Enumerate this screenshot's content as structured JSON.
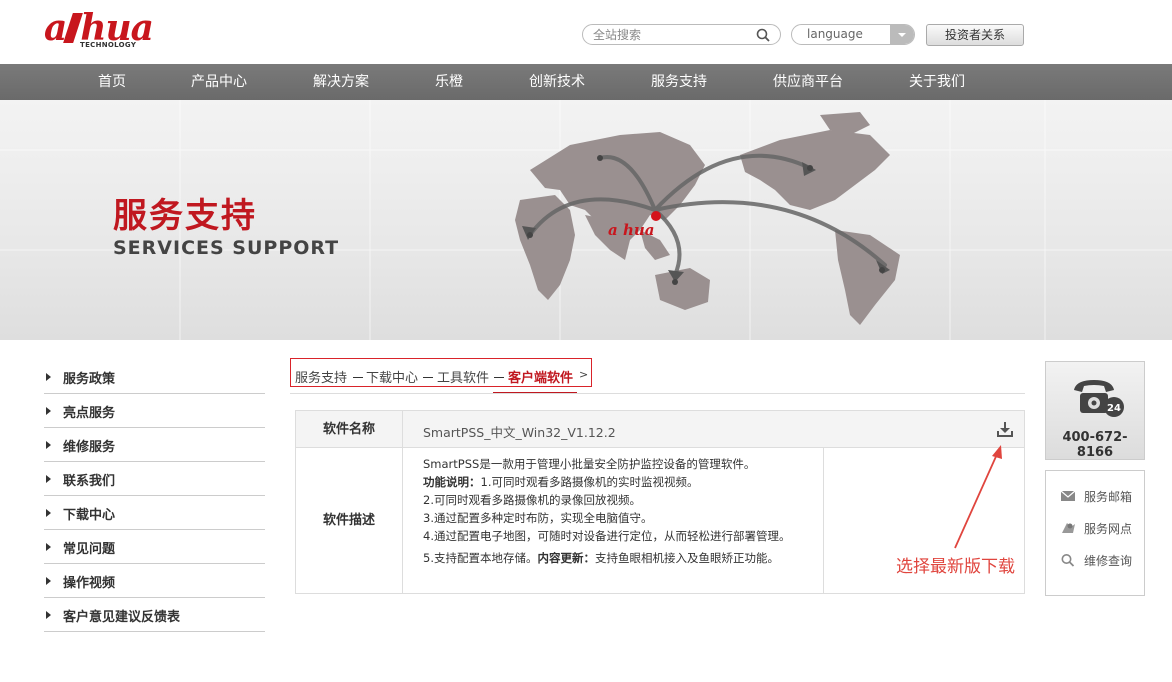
{
  "header": {
    "logo_text": "a",
    "logo_text_rest": "hua",
    "logo_sub": "TECHNOLOGY",
    "search_placeholder": "全站搜索",
    "language_label": "language",
    "investor_button": "投资者关系"
  },
  "nav": {
    "items": [
      {
        "label": "首页"
      },
      {
        "label": "产品中心"
      },
      {
        "label": "解决方案"
      },
      {
        "label": "乐橙"
      },
      {
        "label": "创新技术"
      },
      {
        "label": "服务支持"
      },
      {
        "label": "供应商平台"
      },
      {
        "label": "关于我们"
      }
    ]
  },
  "banner": {
    "title": "服务支持",
    "subtitle": "SERVICES  SUPPORT",
    "map_logo": "a hua"
  },
  "sidebar": {
    "items": [
      {
        "label": "服务政策"
      },
      {
        "label": "亮点服务"
      },
      {
        "label": "维修服务"
      },
      {
        "label": "联系我们"
      },
      {
        "label": "下载中心"
      },
      {
        "label": "常见问题"
      },
      {
        "label": "操作视频"
      },
      {
        "label": "客户意见建议反馈表"
      }
    ]
  },
  "breadcrumb": {
    "items": [
      "服务支持",
      "下载中心",
      "工具软件",
      "客户端软件"
    ],
    "arrow": ">"
  },
  "software": {
    "name_label": "软件名称",
    "name_value": "SmartPSS_中文_Win32_V1.12.2",
    "desc_label": "软件描述",
    "desc_line1": "SmartPSS是一款用于管理小批量安全防护监控设备的管理软件。",
    "desc_func_label": "功能说明：",
    "desc_line2": "1.可同时观看多路摄像机的实时监视视频。",
    "desc_line3": "2.可同时观看多路摄像机的录像回放视频。",
    "desc_line4": "3.通过配置多种定时布防，实现全电脑值守。",
    "desc_line5": "4.通过配置电子地图，可随时对设备进行定位，从而轻松进行部署管理。",
    "desc_line6a": "5.支持配置本地存储。",
    "desc_update_label": "内容更新：",
    "desc_line6b": "支持鱼眼相机接入及鱼眼矫正功能。"
  },
  "annotation": {
    "text": "选择最新版下载",
    "color": "#e0453e"
  },
  "right_panel": {
    "hotline": "400-672-8166",
    "hotline_badge": "24",
    "services": [
      {
        "label": "服务邮箱",
        "icon": "mail-icon"
      },
      {
        "label": "服务网点",
        "icon": "location-icon"
      },
      {
        "label": "维修查询",
        "icon": "search-icon"
      }
    ]
  },
  "colors": {
    "brand_red": "#c8161d",
    "nav_gray": "#707070"
  }
}
